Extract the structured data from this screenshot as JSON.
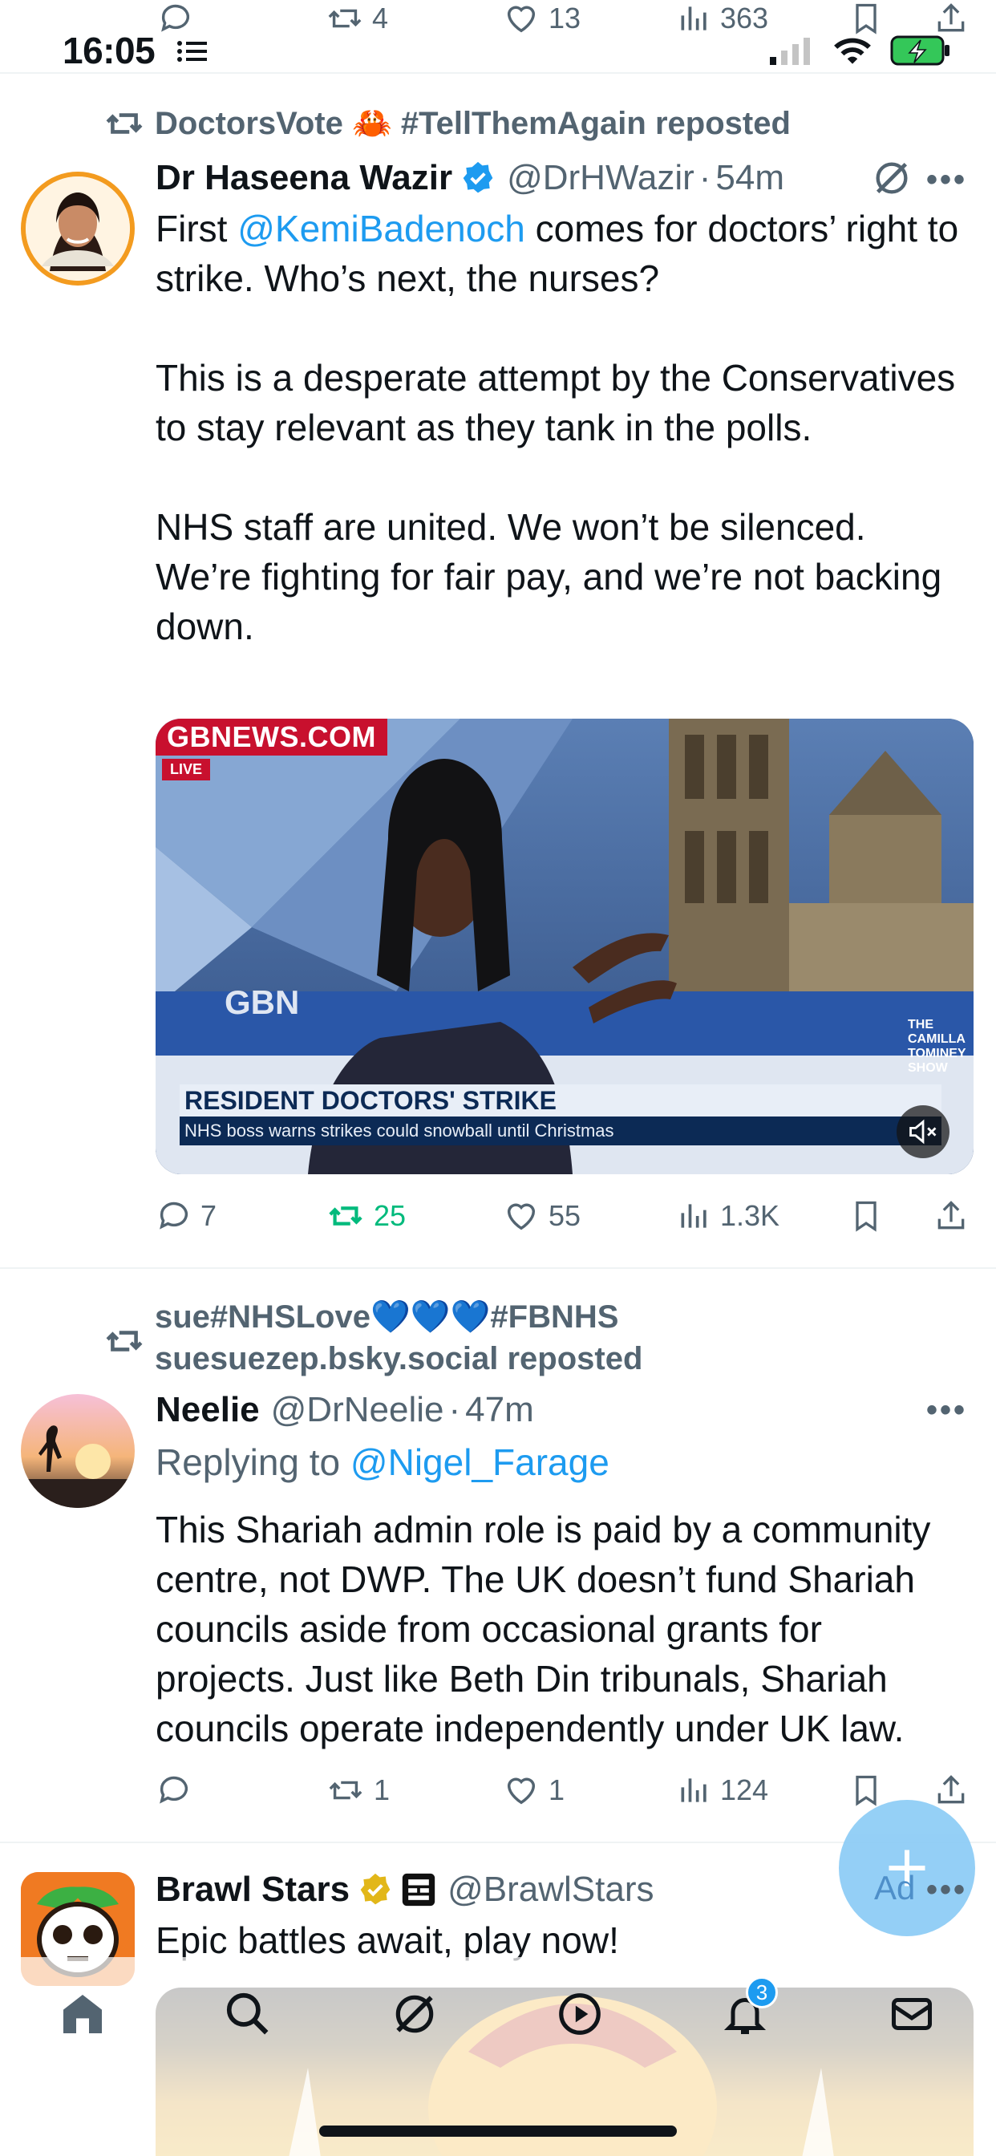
{
  "status_bar": {
    "time": "16:05",
    "scrolled_actions": {
      "retweets": "4",
      "likes": "13",
      "views": "363"
    }
  },
  "tweets": [
    {
      "social_context": "DoctorsVote 🦀 #TellThemAgain reposted",
      "author_name": "Dr Haseena Wazir",
      "verified": true,
      "handle": "@DrHWazir",
      "time": "54m",
      "body_pre": "First ",
      "mention": "@KemiBadenoch",
      "body_post": " comes for doctors’ right to strike. Who’s next, the nurses?\n\nThis is a desperate attempt by the Conservatives to stay relevant as they tank in the polls.\n\nNHS staff are united. We won’t be silenced. We’re fighting for fair pay, and we’re not backing down.",
      "media": {
        "channel_logo": "GBNEWS.COM",
        "live_tag": "LIVE",
        "studio_logo": "GBN",
        "show_name": "THE CAMILLA TOMINEY SHOW",
        "headline": "RESIDENT DOCTORS' STRIKE",
        "subheadline": "NHS boss warns strikes could snowball until Christmas",
        "corner_tag": "GBNEWS.COM"
      },
      "stats": {
        "replies": "7",
        "retweets": "25",
        "likes": "55",
        "views": "1.3K"
      }
    },
    {
      "social_context_line1": "sue#NHSLove💙💙💙#FBNHS",
      "social_context_line2": "suesuezep.bsky.social reposted",
      "author_name": "Neelie",
      "handle": "@DrNeelie",
      "time": "47m",
      "reply_label": "Replying to ",
      "reply_handle": "@Nigel_Farage",
      "body": "This Shariah admin role is paid by a community centre, not DWP. The UK doesn’t fund Shariah councils aside from occasional grants for projects. Just like Beth Din tribunals, Shariah councils operate independently under UK law.",
      "stats": {
        "replies": "",
        "retweets": "1",
        "likes": "1",
        "views": "124"
      }
    },
    {
      "author_name": "Brawl Stars",
      "handle": "@BrawlStars",
      "body": "Epic battles await, play now!"
    }
  ],
  "fab": {
    "ad_label": "Ad"
  },
  "bottom_nav": {
    "notifications_badge": "3"
  },
  "colors": {
    "accent": "#1d9bf0",
    "retweet_active": "#00ba7c",
    "secondary_text": "#536471",
    "gold_check": "#e2b719"
  }
}
